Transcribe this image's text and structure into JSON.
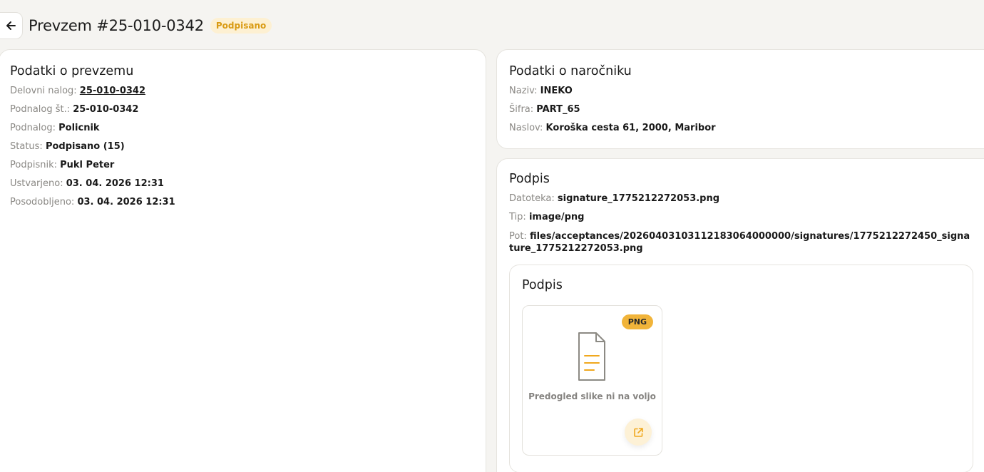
{
  "header": {
    "title": "Prevzem #25-010-0342",
    "status_badge": "Podpisano"
  },
  "acceptance": {
    "title": "Podatki o prevzemu",
    "fields": [
      {
        "label": "Delovni nalog:",
        "value": "25-010-0342"
      },
      {
        "label": "Podnalog št.:",
        "value": "25-010-0342"
      },
      {
        "label": "Podnalog:",
        "value": "Policnik"
      },
      {
        "label": "Status:",
        "value": "Podpisano (15)"
      },
      {
        "label": "Podpisnik:",
        "value": "Pukl Peter"
      },
      {
        "label": "Ustvarjeno:",
        "value": "03. 04. 2026 12:31"
      },
      {
        "label": "Posodobljeno:",
        "value": "03. 04. 2026 12:31"
      }
    ]
  },
  "customer": {
    "title": "Podatki o naročniku",
    "fields": [
      {
        "label": "Naziv:",
        "value": "INEKO"
      },
      {
        "label": "Šifra:",
        "value": "PART_65"
      },
      {
        "label": "Naslov:",
        "value": "Koroška cesta 61, 2000, Maribor"
      }
    ]
  },
  "signature": {
    "title": "Podpis",
    "fields": [
      {
        "label": "Datoteka:",
        "value": "signature_1775212272053.png"
      },
      {
        "label": "Tip:",
        "value": "image/png"
      },
      {
        "label": "Pot:",
        "value": "files/acceptances/20260403103112183064000000/signatures/1775212272450_signature_1775212272053.png"
      }
    ],
    "preview": {
      "title": "Podpis",
      "type_badge": "PNG",
      "no_preview_text": "Predogled slike ni na voljo"
    }
  },
  "icons": {
    "back": "arrow-left-icon",
    "file": "document-icon",
    "open": "external-link-icon"
  },
  "colors": {
    "accent": "#f1b43a",
    "badge_bg": "#fdf0d2",
    "badge_text": "#d99a12",
    "background": "#f5f4f1"
  }
}
